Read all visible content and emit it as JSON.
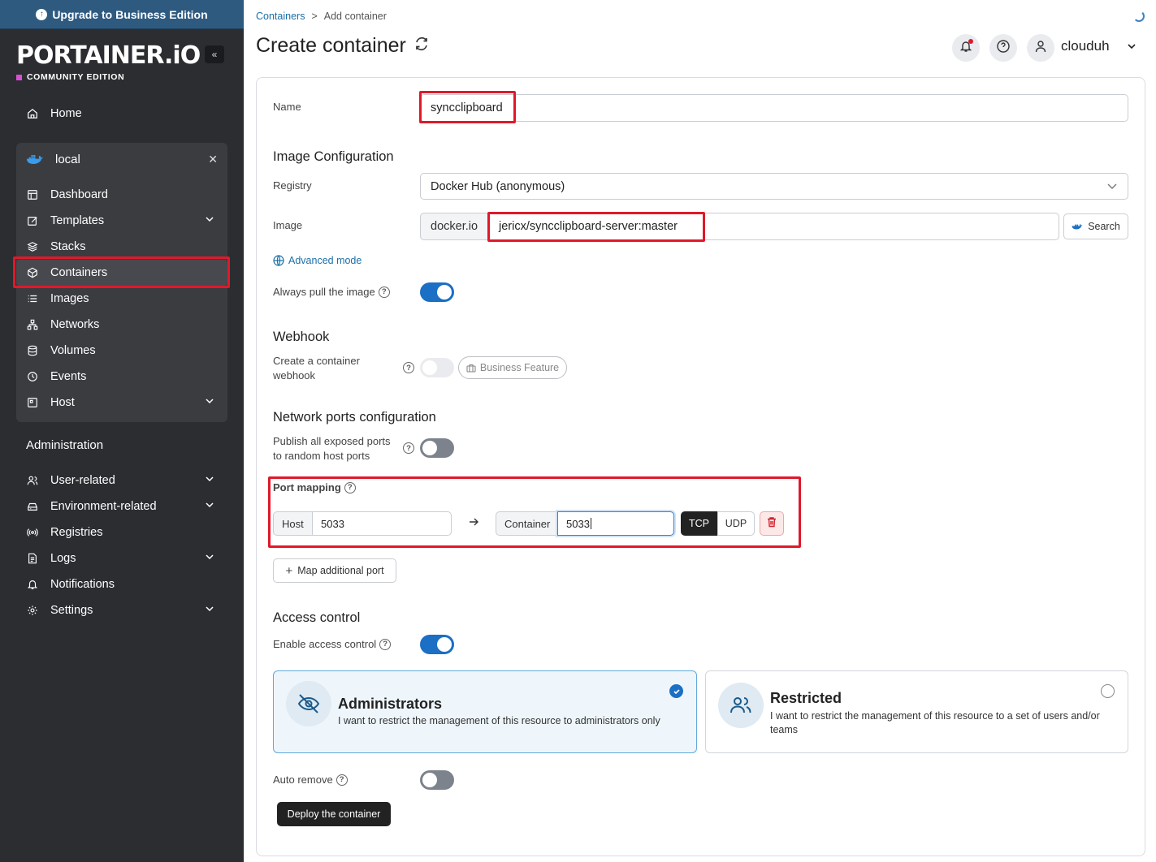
{
  "sidebar": {
    "upgrade_label": "Upgrade to Business Edition",
    "logo": "PORTAINER.iO",
    "edition": "COMMUNITY EDITION",
    "home": "Home",
    "environment": "local",
    "env_items": [
      "Dashboard",
      "Templates",
      "Stacks",
      "Containers",
      "Images",
      "Networks",
      "Volumes",
      "Events",
      "Host"
    ],
    "admin_heading": "Administration",
    "admin_items": [
      "User-related",
      "Environment-related",
      "Registries",
      "Logs",
      "Notifications",
      "Settings"
    ]
  },
  "header": {
    "breadcrumb_root": "Containers",
    "breadcrumb_sep": ">",
    "breadcrumb_current": "Add container",
    "title": "Create container",
    "username": "clouduh"
  },
  "form": {
    "name_label": "Name",
    "name_value": "syncclipboard",
    "image_config_heading": "Image Configuration",
    "registry_label": "Registry",
    "registry_value": "Docker Hub (anonymous)",
    "image_label": "Image",
    "image_prefix": "docker.io",
    "image_value": "jericx/syncclipboard-server:master",
    "search_label": "Search",
    "advanced_mode": "Advanced mode",
    "always_pull_label": "Always pull the image",
    "webhook_heading": "Webhook",
    "webhook_label_1": "Create a container",
    "webhook_label_2": "webhook",
    "business_feature": "Business Feature",
    "network_heading": "Network ports configuration",
    "publish_label_1": "Publish all exposed ports",
    "publish_label_2": "to random host ports",
    "port_mapping_label": "Port mapping",
    "host_addon": "Host",
    "host_value": "5033",
    "container_addon": "Container",
    "container_value": "5033",
    "tcp": "TCP",
    "udp": "UDP",
    "map_additional": "Map additional port",
    "access_heading": "Access control",
    "enable_access_label": "Enable access control",
    "admin_title": "Administrators",
    "admin_desc": "I want to restrict the management of this resource to administrators only",
    "restricted_title": "Restricted",
    "restricted_desc": "I want to restrict the management of this resource to a set of users and/or teams",
    "auto_remove_label": "Auto remove",
    "deploy_label": "Deploy the container"
  },
  "colors": {
    "sidebar_bg": "#2b2d31",
    "upgrade_bg": "#2f5a80",
    "accent_blue": "#1b6fc4",
    "highlight_red": "#e0192a",
    "edition_pink": "#d94fd4"
  }
}
